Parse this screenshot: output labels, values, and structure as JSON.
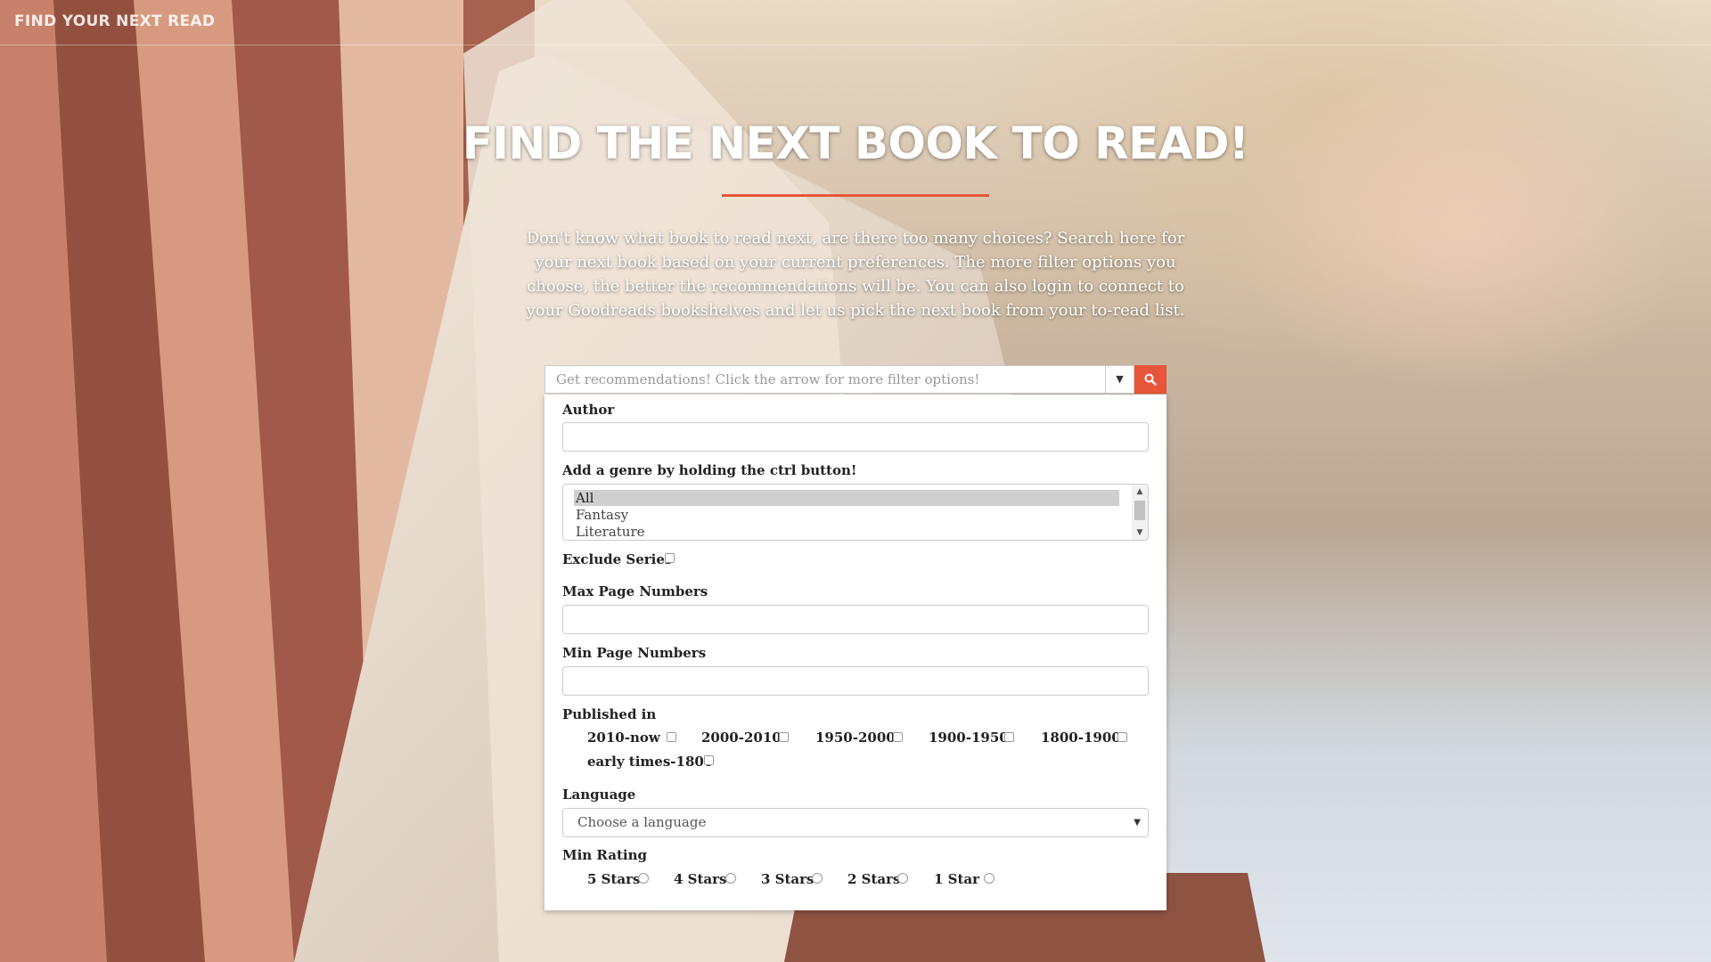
{
  "navbar": {
    "brand": "FIND YOUR NEXT READ"
  },
  "hero": {
    "title": "FIND THE NEXT BOOK TO READ!",
    "description": "Don't know what book to read next, are there too many choices? Search here for your next book based on your current preferences. The more filter options you choose, the better the recommendations will be. You can also login to connect to your Goodreads bookshelves and let us pick the next book from your to-read list."
  },
  "search": {
    "placeholder": "Get recommendations! Click the arrow for more filter options!",
    "toggle_icon": "caret-down-icon",
    "button_icon": "search-icon"
  },
  "filters": {
    "author_label": "Author",
    "genre_label": "Add a genre by holding the ctrl button!",
    "genres": [
      "All",
      "Fantasy",
      "Literature"
    ],
    "genre_selected": "All",
    "exclude_series_label": "Exclude Series",
    "max_pages_label": "Max Page Numbers",
    "min_pages_label": "Min Page Numbers",
    "published_label": "Published in",
    "published_options": [
      "2010-now",
      "2000-2010",
      "1950-2000",
      "1900-1950",
      "1800-1900",
      "early times-1800"
    ],
    "language_label": "Language",
    "language_placeholder": "Choose a language",
    "rating_label": "Min Rating",
    "rating_options": [
      "5 Stars",
      "4 Stars",
      "3 Stars",
      "2 Stars",
      "1 Star"
    ]
  },
  "colors": {
    "accent": "#e8553a"
  }
}
